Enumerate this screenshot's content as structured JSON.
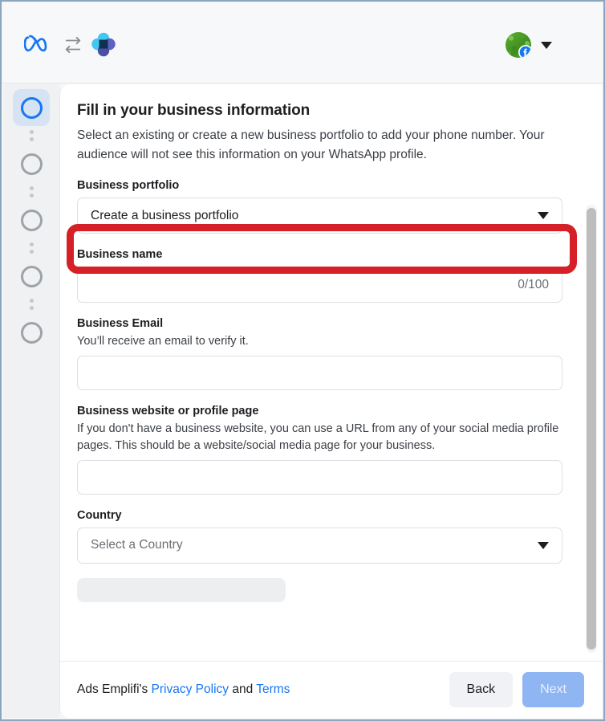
{
  "topbar": {
    "meta_logo": "meta-logo-icon",
    "sync_icon": "sync-arrows-icon",
    "cluster_icon": "cluster-petals-icon",
    "avatar": "user-avatar",
    "avatar_badge": "facebook-badge-icon",
    "account_caret": "caret-down-icon"
  },
  "stepper": {
    "steps": [
      {
        "name": "step-1",
        "state": "active"
      },
      {
        "name": "step-2",
        "state": "inactive"
      },
      {
        "name": "step-3",
        "state": "inactive"
      },
      {
        "name": "step-4",
        "state": "inactive"
      },
      {
        "name": "step-5",
        "state": "inactive"
      }
    ]
  },
  "main": {
    "title": "Fill in your business information",
    "description": "Select an existing or create a new business portfolio to add your phone number. Your audience will not see this information on your WhatsApp profile.",
    "fields": {
      "portfolio": {
        "label": "Business portfolio",
        "value": "Create a business portfolio",
        "type": "select",
        "highlighted": true
      },
      "business_name": {
        "label": "Business name",
        "value": "",
        "placeholder": "",
        "counter": "0/100",
        "type": "text"
      },
      "business_email": {
        "label": "Business Email",
        "help": "You’ll receive an email to verify it.",
        "value": "",
        "placeholder": "",
        "type": "text"
      },
      "business_website": {
        "label": "Business website or profile page",
        "help": "If you don't have a business website, you can use a URL from any of your social media profile pages. This should be a website/social media page for your business.",
        "value": "",
        "placeholder": "",
        "type": "text"
      },
      "country": {
        "label": "Country",
        "value": "",
        "placeholder": "Select a Country",
        "type": "select"
      }
    }
  },
  "footer": {
    "legal_prefix": "Ads Emplifi's",
    "privacy_link": "Privacy Policy",
    "legal_conjunction": "and",
    "terms_link": "Terms",
    "back_label": "Back",
    "next_label": "Next"
  },
  "colors": {
    "accent_blue": "#1877f2",
    "highlight_red": "#d62027",
    "next_disabled": "#8fb5f2",
    "window_border": "#8ba7bd"
  }
}
